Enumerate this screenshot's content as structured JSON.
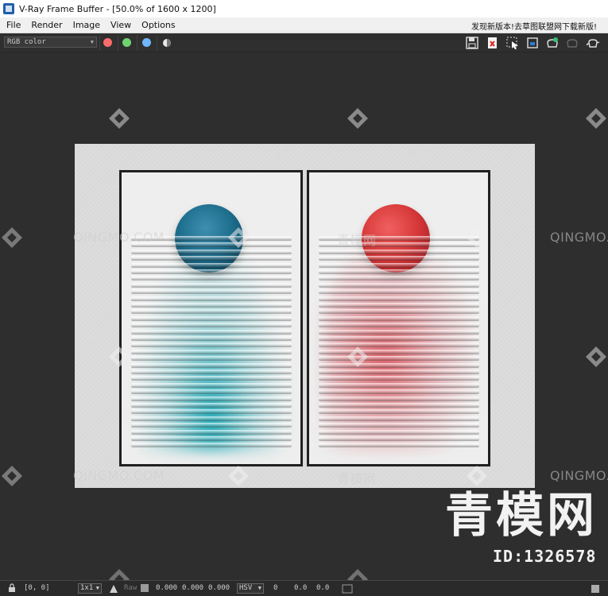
{
  "window": {
    "title": "V-Ray Frame Buffer - [50.0% of 1600 x 1200]"
  },
  "menu": {
    "items": [
      "File",
      "Render",
      "Image",
      "View",
      "Options"
    ],
    "note": "发现新版本!去草图联盟网下载新版!"
  },
  "toolbar": {
    "channel": "RGB color",
    "color_toggles": [
      {
        "name": "red-channel-toggle",
        "color": "#ff6b6b"
      },
      {
        "name": "green-channel-toggle",
        "color": "#6fd36f"
      },
      {
        "name": "blue-channel-toggle",
        "color": "#6fb6ff"
      }
    ],
    "right_icons": [
      "save-icon",
      "clear-icon",
      "region-render-icon",
      "track-mouse-icon",
      "render-icon",
      "stop-render-icon",
      "teapot-icon"
    ]
  },
  "watermark": {
    "brand": "QINGMO.COM",
    "brand_cn": "青模网",
    "big_text": "青模网",
    "id_text": "ID:1326578"
  },
  "artwork": {
    "left_color": "#1e6f8e",
    "right_color": "#d83a3a"
  },
  "statusbar": {
    "coords": "[0, 0]",
    "zoom": "1x1",
    "raw_label": "Raw",
    "rgb_values": [
      "0.000",
      "0.000",
      "0.000"
    ],
    "mode": "HSV",
    "hsv_values": [
      "0",
      "0.0",
      "0.0"
    ]
  }
}
